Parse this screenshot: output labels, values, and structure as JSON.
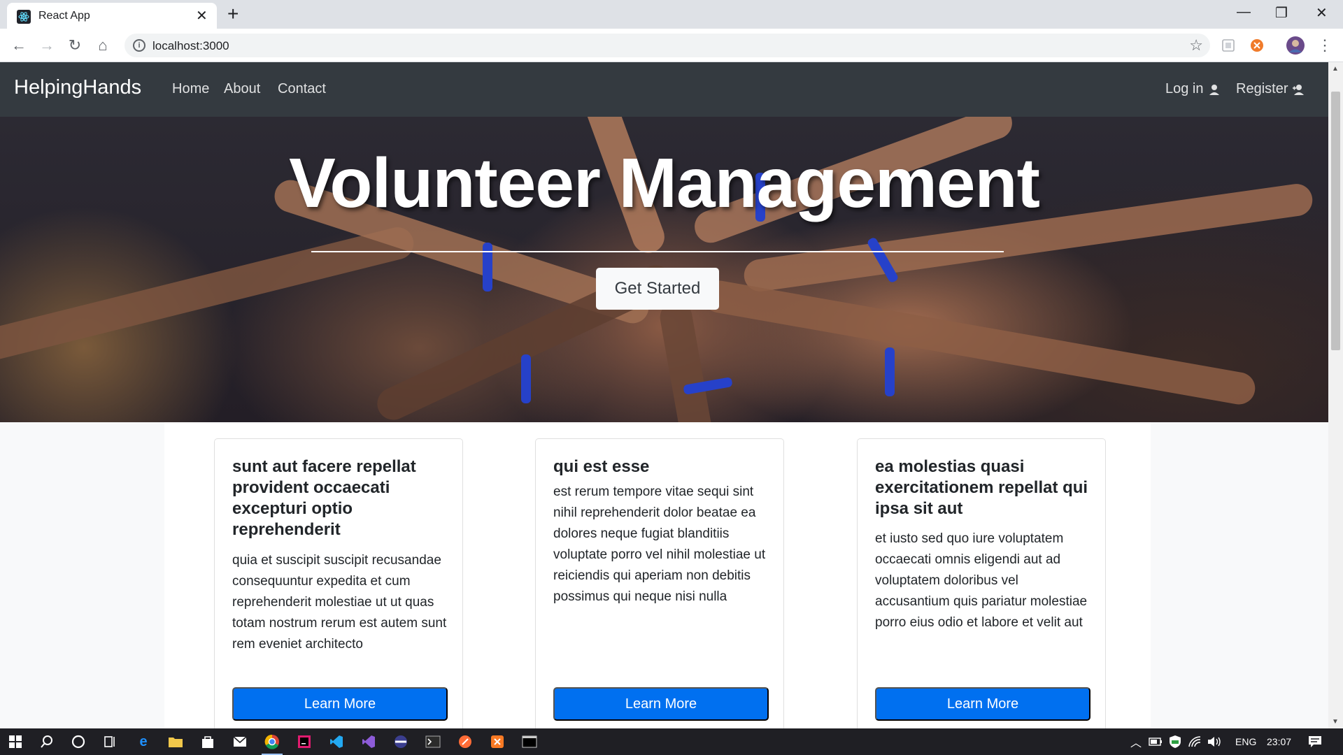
{
  "browser": {
    "tab_title": "React App",
    "url": "localhost:3000"
  },
  "navbar": {
    "brand": "HelpingHands",
    "links": [
      "Home",
      "About",
      "Contact"
    ],
    "login_label": "Log in",
    "register_label": "Register"
  },
  "hero": {
    "title": "Volunteer Management",
    "button_label": "Get Started"
  },
  "cards": [
    {
      "title": "sunt aut facere repellat provident occaecati excepturi optio reprehenderit",
      "body": "quia et suscipit suscipit recusandae consequuntur expedita et cum reprehenderit molestiae ut ut quas totam nostrum rerum est autem sunt rem eveniet architecto",
      "button_label": "Learn More"
    },
    {
      "title": "qui est esse",
      "body": "est rerum tempore vitae sequi sint nihil reprehenderit dolor beatae ea dolores neque fugiat blanditiis voluptate porro vel nihil molestiae ut reiciendis qui aperiam non debitis possimus qui neque nisi nulla",
      "button_label": "Learn More"
    },
    {
      "title": "ea molestias quasi exercitationem repellat qui ipsa sit aut",
      "body": "et iusto sed quo iure voluptatem occaecati omnis eligendi aut ad voluptatem doloribus vel accusantium quis pariatur molestiae porro eius odio et labore et velit aut",
      "button_label": "Learn More"
    }
  ],
  "taskbar": {
    "language": "ENG",
    "clock": "23:07"
  },
  "colors": {
    "navbar_bg": "#343a40",
    "primary_button": "#0070f0",
    "hero_button_bg": "#f8f9fa"
  }
}
